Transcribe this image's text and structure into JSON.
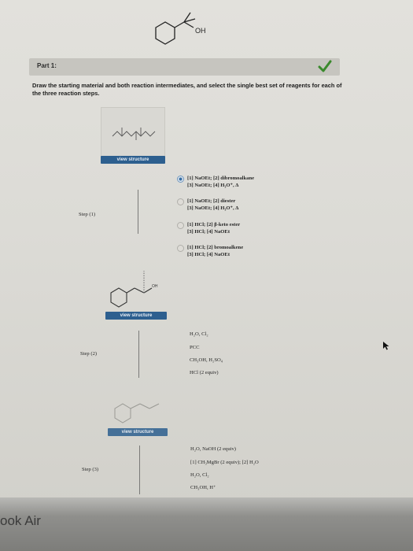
{
  "product": {
    "molecule_label": "OH"
  },
  "part": {
    "title": "Part 1:",
    "complete": true
  },
  "instructions": "Draw the starting material and both reaction intermediates, and select the single best set of reagents for each of the three reaction steps.",
  "view_structure_label": "view structure",
  "step1": {
    "label": "Step (1)",
    "options": [
      {
        "line1": "[1] NaOEt; [2] dibromoalkane",
        "line2": "[3] NaOEt; [4] H₃O⁺, Δ",
        "selected": true
      },
      {
        "line1": "[1] NaOEt; [2] diester",
        "line2": "[3] NaOEt; [4] H₃O⁺, Δ",
        "selected": false
      },
      {
        "line1": "[1] HCl; [2] β-keto ester",
        "line2": "[3] HCl; [4] NaOEt",
        "selected": false
      },
      {
        "line1": "[1] HCl; [2] bromoalkene",
        "line2": "[3] HCl; [4] NaOEt",
        "selected": false
      }
    ]
  },
  "intermediate1": {
    "oh_label": "OH"
  },
  "step2": {
    "label": "Step (2)",
    "options": [
      "H₂O, Cl₂",
      "PCC",
      "CH₃OH, H₂SO₄",
      "HCl (2 equiv)"
    ]
  },
  "step3": {
    "label": "Step (3)",
    "options": [
      "H₂O, NaOH (2 equiv)",
      "[1] CH₃MgBr (2 equiv); [2] H₂O",
      "H₂O, Cl₂",
      "CH₃OH, H⁺"
    ]
  },
  "bezel": {
    "text": "ook Air"
  },
  "colors": {
    "accent": "#2d5f8f",
    "check": "#3a8a2c"
  }
}
